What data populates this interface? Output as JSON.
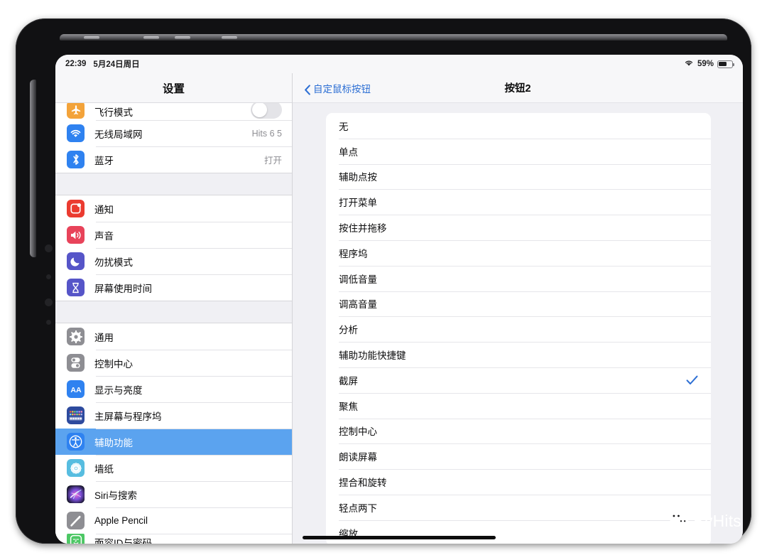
{
  "status_bar": {
    "time": "22:39",
    "date": "5月24日周日",
    "wifi_icon": "wifi-icon",
    "battery_percent": "59%",
    "battery_level": 59,
    "battery_icon": "battery-icon"
  },
  "sidebar": {
    "title": "设置",
    "groups": [
      {
        "items": [
          {
            "label": "飞行模式",
            "icon": "airplane-icon",
            "icon_color": "#f3a33a",
            "accessory": "toggle",
            "toggle_on": false,
            "clipped": true
          },
          {
            "label": "无线局域网",
            "icon": "wifi-icon",
            "icon_color": "#2f82f0",
            "accessory": "value",
            "value": "Hits 6 5"
          },
          {
            "label": "蓝牙",
            "icon": "bluetooth-icon",
            "icon_color": "#2f82f0",
            "accessory": "value",
            "value": "打开"
          }
        ]
      },
      {
        "items": [
          {
            "label": "通知",
            "icon": "notifications-icon",
            "icon_color": "#eb3b30"
          },
          {
            "label": "声音",
            "icon": "sound-icon",
            "icon_color": "#e8435a"
          },
          {
            "label": "勿扰模式",
            "icon": "moon-icon",
            "icon_color": "#5655c8"
          },
          {
            "label": "屏幕使用时间",
            "icon": "hourglass-icon",
            "icon_color": "#5655c8"
          }
        ]
      },
      {
        "items": [
          {
            "label": "通用",
            "icon": "gear-icon",
            "icon_color": "#8e8e93"
          },
          {
            "label": "控制中心",
            "icon": "control-center-icon",
            "icon_color": "#8e8e93"
          },
          {
            "label": "显示与亮度",
            "icon": "display-brightness-icon",
            "icon_color": "#2f82f0"
          },
          {
            "label": "主屏幕与程序坞",
            "icon": "home-screen-dock-icon",
            "icon_color": "#2d4a9e"
          },
          {
            "label": "辅助功能",
            "icon": "accessibility-icon",
            "icon_color": "#2f82f0",
            "selected": true
          },
          {
            "label": "墙纸",
            "icon": "wallpaper-icon",
            "icon_color": "#57bde0"
          },
          {
            "label": "Siri与搜索",
            "icon": "siri-icon",
            "icon_color": "#1b1b2e"
          },
          {
            "label": "Apple Pencil",
            "icon": "apple-pencil-icon",
            "icon_color": "#8e8e93"
          },
          {
            "label": "面容ID与密码",
            "icon": "face-id-icon",
            "icon_color": "#4cc764",
            "clipped": true
          }
        ]
      }
    ]
  },
  "detail": {
    "back_label": "自定鼠标按钮",
    "back_icon": "chevron-left-icon",
    "title": "按钮2",
    "selected_color": "#2d6fd4",
    "options": [
      {
        "label": "无",
        "checked": false
      },
      {
        "label": "单点",
        "checked": false
      },
      {
        "label": "辅助点按",
        "checked": false
      },
      {
        "label": "打开菜单",
        "checked": false
      },
      {
        "label": "按住并拖移",
        "checked": false
      },
      {
        "label": "程序坞",
        "checked": false
      },
      {
        "label": "调低音量",
        "checked": false
      },
      {
        "label": "调高音量",
        "checked": false
      },
      {
        "label": "分析",
        "checked": false
      },
      {
        "label": "辅助功能快捷键",
        "checked": false
      },
      {
        "label": "截屏",
        "checked": true
      },
      {
        "label": "聚焦",
        "checked": false
      },
      {
        "label": "控制中心",
        "checked": false
      },
      {
        "label": "朗读屏幕",
        "checked": false
      },
      {
        "label": "捏合和旋转",
        "checked": false
      },
      {
        "label": "轻点两下",
        "checked": false
      },
      {
        "label": "缩放",
        "checked": false
      }
    ]
  },
  "watermark": {
    "text": "ByHits",
    "icon": "wechat-icon"
  }
}
